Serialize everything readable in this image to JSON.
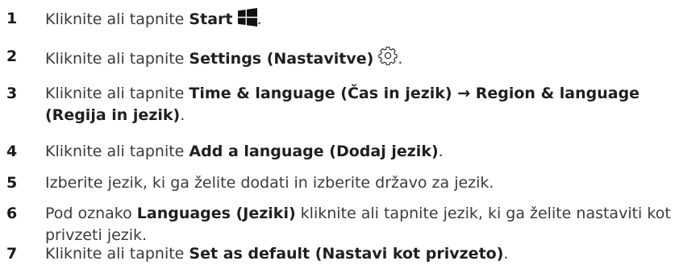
{
  "steps": [
    {
      "number": "1",
      "prefix": "Kliknite ali tapnite ",
      "bold": "Start",
      "suffix": ".",
      "icon": "windows-logo-icon"
    },
    {
      "number": "2",
      "prefix": "Kliknite ali tapnite ",
      "bold": "Settings (Nastavitve)",
      "suffix": ".",
      "icon": "gear-icon"
    },
    {
      "number": "3",
      "prefix": "Kliknite ali tapnite ",
      "bold": "Time & language (Čas in jezik) → Region & language (Regija in jezik)",
      "suffix": "."
    },
    {
      "number": "4",
      "prefix": "Kliknite ali tapnite ",
      "bold": "Add a language (Dodaj jezik)",
      "suffix": "."
    },
    {
      "number": "5",
      "text": "Izberite jezik, ki ga želite dodati in izberite državo za jezik."
    },
    {
      "number": "6",
      "prefix": "Pod oznako ",
      "bold": "Languages (Jeziki)",
      "suffix": " kliknite ali tapnite jezik, ki ga želite nastaviti kot privzeti jezik."
    },
    {
      "number": "7",
      "prefix": "Kliknite ali tapnite ",
      "bold": "Set as default (Nastavi kot privzeto)",
      "suffix": "."
    }
  ]
}
